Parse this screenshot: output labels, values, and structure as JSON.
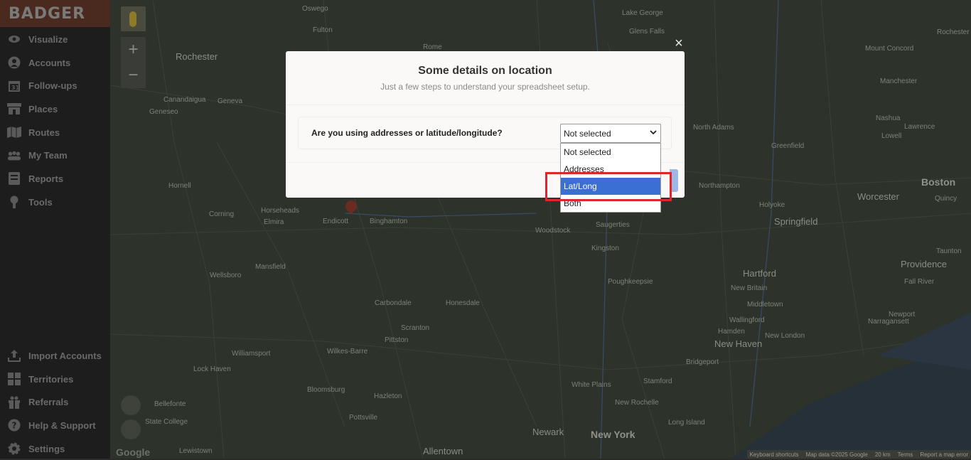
{
  "app": {
    "logo": "BADGER"
  },
  "sidebar": {
    "top_items": [
      {
        "label": "Visualize",
        "icon": "eye-icon"
      },
      {
        "label": "Accounts",
        "icon": "user-circle-icon"
      },
      {
        "label": "Follow-ups",
        "icon": "calendar-icon"
      },
      {
        "label": "Places",
        "icon": "store-icon"
      },
      {
        "label": "Routes",
        "icon": "map-icon"
      },
      {
        "label": "My Team",
        "icon": "team-icon"
      },
      {
        "label": "Reports",
        "icon": "report-icon"
      },
      {
        "label": "Tools",
        "icon": "tools-icon"
      }
    ],
    "bottom_items": [
      {
        "label": "Import Accounts",
        "icon": "upload-icon"
      },
      {
        "label": "Territories",
        "icon": "territories-icon"
      },
      {
        "label": "Referrals",
        "icon": "gift-icon"
      },
      {
        "label": "Help & Support",
        "icon": "help-icon"
      },
      {
        "label": "Settings",
        "icon": "gear-icon"
      }
    ]
  },
  "map": {
    "zoom_in": "+",
    "zoom_out": "−",
    "google": "Google",
    "footer": [
      "Keyboard shortcuts",
      "Map data ©2025 Google",
      "20 km",
      "Terms",
      "Report a map error"
    ],
    "cities": [
      {
        "name": "Oswego",
        "cls": ""
      },
      {
        "name": "Fulton",
        "cls": ""
      },
      {
        "name": "Rochester",
        "cls": "big"
      },
      {
        "name": "Lake George",
        "cls": ""
      },
      {
        "name": "Glens Falls",
        "cls": ""
      },
      {
        "name": "Rome",
        "cls": ""
      },
      {
        "name": "Rochester",
        "cls": ""
      },
      {
        "name": "Canandaigua",
        "cls": ""
      },
      {
        "name": "Geneva",
        "cls": ""
      },
      {
        "name": "Geneseo",
        "cls": ""
      },
      {
        "name": "Mount Concord",
        "cls": ""
      },
      {
        "name": "Manchester",
        "cls": ""
      },
      {
        "name": "Nashua",
        "cls": ""
      },
      {
        "name": "Lawrence",
        "cls": ""
      },
      {
        "name": "Lowell",
        "cls": ""
      },
      {
        "name": "North Adams",
        "cls": ""
      },
      {
        "name": "Greenfield",
        "cls": ""
      },
      {
        "name": "Hornell",
        "cls": ""
      },
      {
        "name": "Northampton",
        "cls": ""
      },
      {
        "name": "Worcester",
        "cls": "big"
      },
      {
        "name": "Boston",
        "cls": "bold"
      },
      {
        "name": "Quincy",
        "cls": ""
      },
      {
        "name": "Corning",
        "cls": ""
      },
      {
        "name": "Horseheads",
        "cls": ""
      },
      {
        "name": "Elmira",
        "cls": ""
      },
      {
        "name": "Endicott",
        "cls": ""
      },
      {
        "name": "Binghamton",
        "cls": ""
      },
      {
        "name": "Woodstock",
        "cls": ""
      },
      {
        "name": "Saugerties",
        "cls": ""
      },
      {
        "name": "Holyoke",
        "cls": ""
      },
      {
        "name": "Springfield",
        "cls": "big"
      },
      {
        "name": "Kingston",
        "cls": ""
      },
      {
        "name": "Taunton",
        "cls": ""
      },
      {
        "name": "Mansfield",
        "cls": ""
      },
      {
        "name": "Wellsboro",
        "cls": ""
      },
      {
        "name": "Hartford",
        "cls": "big"
      },
      {
        "name": "Providence",
        "cls": "big"
      },
      {
        "name": "Poughkeepsie",
        "cls": ""
      },
      {
        "name": "New Britain",
        "cls": ""
      },
      {
        "name": "Fall River",
        "cls": ""
      },
      {
        "name": "Carbondale",
        "cls": ""
      },
      {
        "name": "Honesdale",
        "cls": ""
      },
      {
        "name": "Middletown",
        "cls": ""
      },
      {
        "name": "Newport",
        "cls": ""
      },
      {
        "name": "Scranton",
        "cls": ""
      },
      {
        "name": "Wallingford",
        "cls": ""
      },
      {
        "name": "Narragansett",
        "cls": ""
      },
      {
        "name": "Pittston",
        "cls": ""
      },
      {
        "name": "Hamden",
        "cls": ""
      },
      {
        "name": "New London",
        "cls": ""
      },
      {
        "name": "New Haven",
        "cls": "big"
      },
      {
        "name": "Williamsport",
        "cls": ""
      },
      {
        "name": "Wilkes-Barre",
        "cls": ""
      },
      {
        "name": "Bridgeport",
        "cls": ""
      },
      {
        "name": "Lock Haven",
        "cls": ""
      },
      {
        "name": "Stamford",
        "cls": ""
      },
      {
        "name": "Bloomsburg",
        "cls": ""
      },
      {
        "name": "White Plains",
        "cls": ""
      },
      {
        "name": "Hazleton",
        "cls": ""
      },
      {
        "name": "Bellefonte",
        "cls": ""
      },
      {
        "name": "New Rochelle",
        "cls": ""
      },
      {
        "name": "State College",
        "cls": ""
      },
      {
        "name": "Pottsville",
        "cls": ""
      },
      {
        "name": "Long Island",
        "cls": ""
      },
      {
        "name": "Newark",
        "cls": "big"
      },
      {
        "name": "New York",
        "cls": "bold"
      },
      {
        "name": "Lewistown",
        "cls": ""
      },
      {
        "name": "Allentown",
        "cls": "big"
      }
    ]
  },
  "modal": {
    "close": "×",
    "title": "Some details on location",
    "subtitle": "Just a few steps to understand your spreadsheet setup.",
    "question": "Are you using addresses or latitude/longitude?",
    "select_value": "Not selected",
    "options": [
      "Not selected",
      "Addresses",
      "Lat/Long",
      "Both"
    ],
    "highlighted_option": "Lat/Long"
  },
  "colors": {
    "highlight_border": "#e0252d",
    "option_selected": "#3c6fd3"
  }
}
